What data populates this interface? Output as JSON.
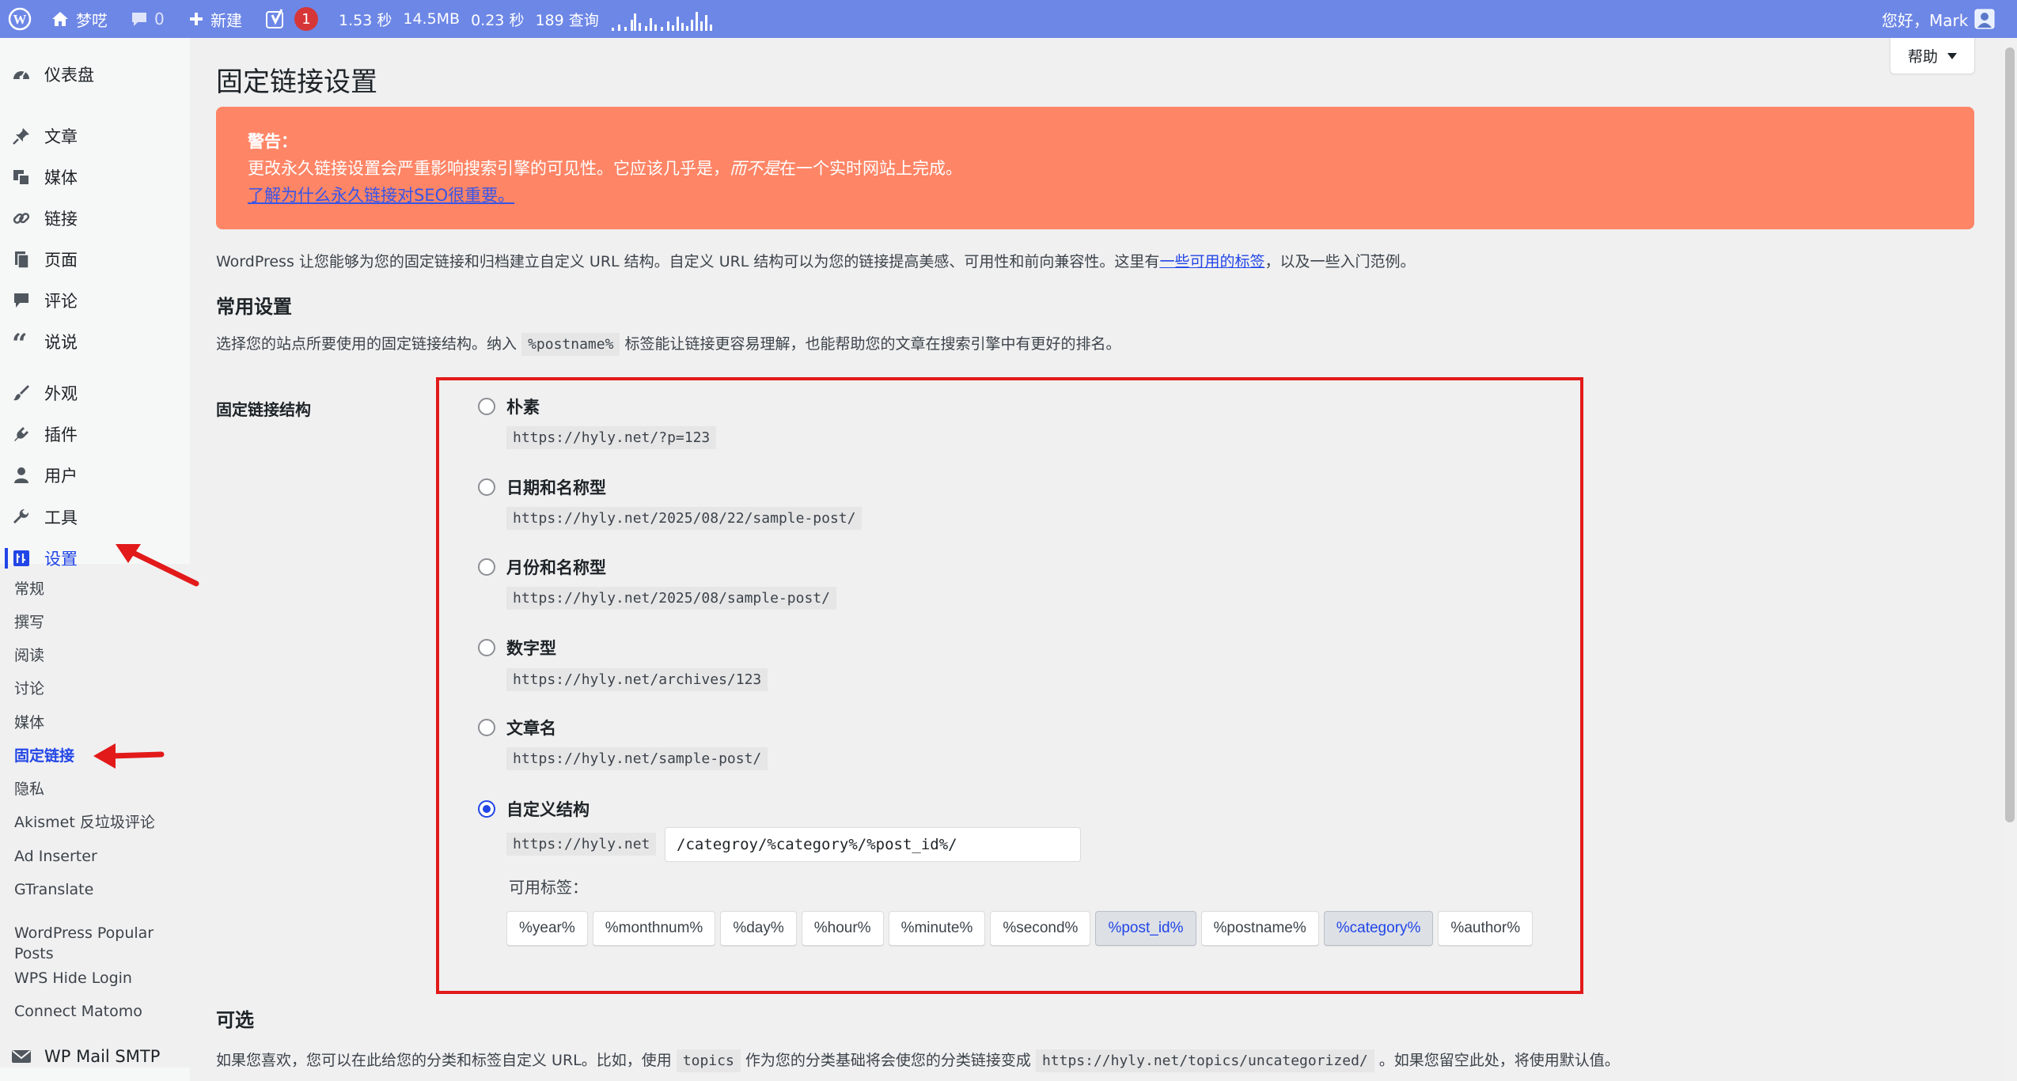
{
  "adminbar": {
    "site_name": "梦呓",
    "comments_count": "0",
    "new_label": "新建",
    "notification_count": "1",
    "stats": {
      "time1": "1.53 秒",
      "memory": "14.5MB",
      "time2": "0.23 秒",
      "queries": "189 查询"
    },
    "greeting": "您好，Mark"
  },
  "sidebar": {
    "items": [
      {
        "label": "仪表盘",
        "icon": "dashboard-icon"
      },
      {
        "label": "文章",
        "icon": "pin-icon"
      },
      {
        "label": "媒体",
        "icon": "media-icon"
      },
      {
        "label": "链接",
        "icon": "link-icon"
      },
      {
        "label": "页面",
        "icon": "page-icon"
      },
      {
        "label": "评论",
        "icon": "comment-icon"
      },
      {
        "label": "说说",
        "icon": "quote-icon"
      },
      {
        "label": "外观",
        "icon": "brush-icon"
      },
      {
        "label": "插件",
        "icon": "plugin-icon"
      },
      {
        "label": "用户",
        "icon": "user-icon"
      },
      {
        "label": "工具",
        "icon": "wrench-icon"
      },
      {
        "label": "设置",
        "icon": "settings-icon"
      }
    ],
    "submenu": [
      "常规",
      "撰写",
      "阅读",
      "讨论",
      "媒体",
      "固定链接",
      "隐私",
      "Akismet 反垃圾评论",
      "Ad Inserter",
      "GTranslate",
      "WordPress Popular Posts",
      "WPS Hide Login",
      "Connect Matomo"
    ],
    "bottom_item": {
      "label": "WP Mail SMTP",
      "icon": "mail-icon"
    }
  },
  "help_label": "帮助",
  "page_title": "固定链接设置",
  "warning": {
    "title": "警告：",
    "text_before": "更改永久链接设置会严重影响搜索引擎的可见性。它应该几乎是，",
    "text_em": "而不是",
    "text_after": "在一个实时网站上完成。",
    "link": "了解为什么永久链接对SEO很重要。"
  },
  "intro": {
    "before": "WordPress 让您能够为您的固定链接和归档建立自定义 URL 结构。自定义 URL 结构可以为您的链接提高美感、可用性和前向兼容性。这里有",
    "link": "一些可用的标签",
    "after": "，以及一些入门范例。"
  },
  "common": {
    "heading": "常用设置",
    "desc_before": "选择您的站点所要使用的固定链接结构。纳入",
    "desc_code": "%postname%",
    "desc_after": "标签能让链接更容易理解，也能帮助您的文章在搜索引擎中有更好的排名。",
    "field_label": "固定链接结构"
  },
  "options": [
    {
      "label": "朴素",
      "example": "https://hyly.net/?p=123",
      "checked": false
    },
    {
      "label": "日期和名称型",
      "example": "https://hyly.net/2025/08/22/sample-post/",
      "checked": false
    },
    {
      "label": "月份和名称型",
      "example": "https://hyly.net/2025/08/sample-post/",
      "checked": false
    },
    {
      "label": "数字型",
      "example": "https://hyly.net/archives/123",
      "checked": false
    },
    {
      "label": "文章名",
      "example": "https://hyly.net/sample-post/",
      "checked": false
    },
    {
      "label": "自定义结构",
      "example": "",
      "checked": true
    }
  ],
  "custom": {
    "base": "https://hyly.net",
    "value": "/categroy/%category%/%post_id%/",
    "tags_label": "可用标签：",
    "tags": [
      {
        "label": "%year%",
        "active": false
      },
      {
        "label": "%monthnum%",
        "active": false
      },
      {
        "label": "%day%",
        "active": false
      },
      {
        "label": "%hour%",
        "active": false
      },
      {
        "label": "%minute%",
        "active": false
      },
      {
        "label": "%second%",
        "active": false
      },
      {
        "label": "%post_id%",
        "active": true
      },
      {
        "label": "%postname%",
        "active": false
      },
      {
        "label": "%category%",
        "active": true
      },
      {
        "label": "%author%",
        "active": false
      }
    ]
  },
  "optional": {
    "heading": "可选",
    "before": "如果您喜欢，您可以在此给您的分类和标签自定义 URL。比如，使用",
    "code1": "topics",
    "middle": "作为您的分类基础将会使您的分类链接变成",
    "code2": "https://hyly.net/topics/uncategorized/",
    "after": "。如果您留空此处，将使用默认值。"
  },
  "colors": {
    "adminbar": "#6d87e6",
    "warning": "#fe8566",
    "accent": "#2145e6",
    "annotation": "#e21a1a"
  }
}
